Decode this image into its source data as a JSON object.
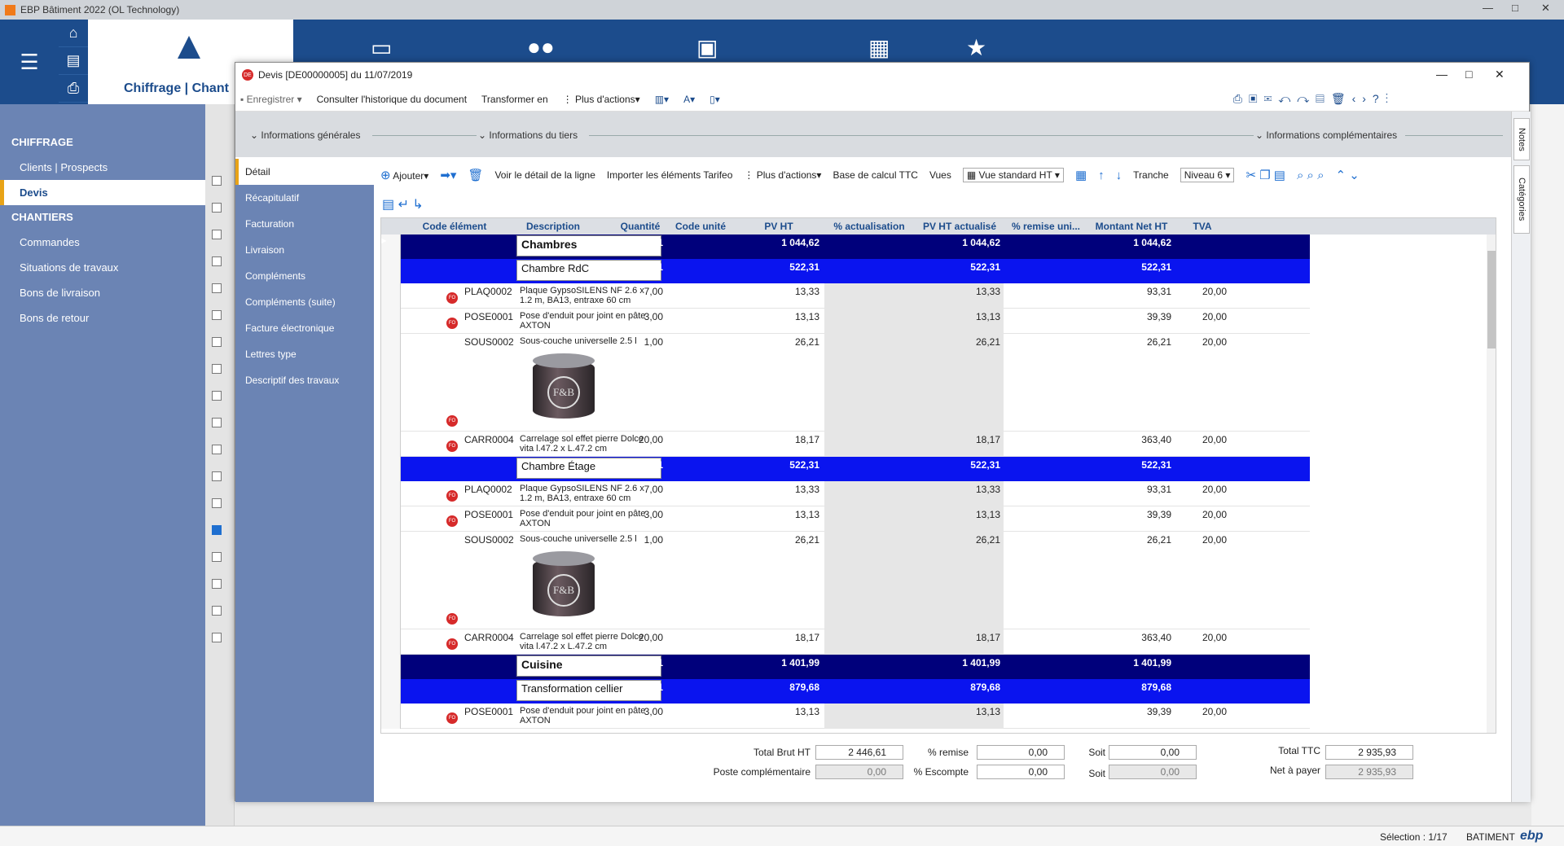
{
  "app": {
    "title": "EBP Bâtiment 2022 (OL Technology)"
  },
  "module": {
    "label": "Chiffrage | Chant"
  },
  "sidebar": {
    "sections": [
      {
        "title": "CHIFFRAGE",
        "items": [
          "Clients | Prospects",
          "Devis"
        ]
      },
      {
        "title": "CHANTIERS",
        "items": [
          "Commandes",
          "Situations de travaux",
          "Bons de livraison",
          "Bons de retour"
        ]
      }
    ],
    "active": "Devis"
  },
  "dialog": {
    "title": "Devis [DE00000005] du 11/07/2019",
    "badge": "DE",
    "toolbar": {
      "save": "Enregistrer",
      "history": "Consulter l'historique du document",
      "transform": "Transformer en",
      "more": "Plus d'actions"
    },
    "sections": [
      "Informations générales",
      "Informations du tiers",
      "Informations complémentaires"
    ],
    "side_tabs": [
      "Détail",
      "Récapitulatif",
      "Facturation",
      "Livraison",
      "Compléments",
      "Compléments (suite)",
      "Facture électronique",
      "Lettres type",
      "Descriptif des travaux"
    ],
    "right_tabs": [
      "Notes",
      "Catégories"
    ]
  },
  "content_toolbar": {
    "add": "Ajouter",
    "view_detail": "Voir le détail de la ligne",
    "import": "Importer les éléments Tarifeo",
    "more": "Plus d'actions",
    "base": "Base de calcul TTC",
    "views_label": "Vues",
    "views_value": "Vue standard HT",
    "tranche_label": "Tranche",
    "tranche_value": "Niveau 6"
  },
  "grid": {
    "columns": [
      "Code élément",
      "Description",
      "Quantité",
      "Code unité",
      "PV HT",
      "% actualisation",
      "PV HT actualisé",
      "% remise uni...",
      "Montant Net HT",
      "TVA"
    ],
    "rows": [
      {
        "level": 1,
        "desc": "Chambres",
        "qty": "1",
        "pv": "1 044,62",
        "pva": "1 044,62",
        "net": "1 044,62"
      },
      {
        "level": 2,
        "desc": "Chambre RdC",
        "qty": "1",
        "pv": "522,31",
        "pva": "522,31",
        "net": "522,31"
      },
      {
        "level": 3,
        "code": "PLAQ0002",
        "desc": "Plaque GypsoSILENS NF 2.6 x 1.2 m, BA13, entraxe 60 cm",
        "qty": "7,00",
        "pv": "13,33",
        "pva": "13,33",
        "net": "93,31",
        "tva": "20,00"
      },
      {
        "level": 3,
        "code": "POSE0001",
        "desc": "Pose d'enduit pour joint en pâte AXTON",
        "qty": "3,00",
        "pv": "13,13",
        "pva": "13,13",
        "net": "39,39",
        "tva": "20,00"
      },
      {
        "level": 3,
        "code": "SOUS0002",
        "desc": "Sous-couche universelle 2.5 l",
        "qty": "1,00",
        "pv": "26,21",
        "pva": "26,21",
        "net": "26,21",
        "tva": "20,00",
        "image": "F&B"
      },
      {
        "level": 3,
        "code": "CARR0004",
        "desc": "Carrelage sol effet pierre Dolce vita l.47.2 x L.47.2 cm",
        "qty": "20,00",
        "pv": "18,17",
        "pva": "18,17",
        "net": "363,40",
        "tva": "20,00"
      },
      {
        "level": 2,
        "desc": "Chambre Étage",
        "qty": "1",
        "pv": "522,31",
        "pva": "522,31",
        "net": "522,31"
      },
      {
        "level": 3,
        "code": "PLAQ0002",
        "desc": "Plaque GypsoSILENS NF 2.6 x 1.2 m, BA13, entraxe 60 cm",
        "qty": "7,00",
        "pv": "13,33",
        "pva": "13,33",
        "net": "93,31",
        "tva": "20,00"
      },
      {
        "level": 3,
        "code": "POSE0001",
        "desc": "Pose d'enduit pour joint en pâte AXTON",
        "qty": "3,00",
        "pv": "13,13",
        "pva": "13,13",
        "net": "39,39",
        "tva": "20,00"
      },
      {
        "level": 3,
        "code": "SOUS0002",
        "desc": "Sous-couche universelle 2.5 l",
        "qty": "1,00",
        "pv": "26,21",
        "pva": "26,21",
        "net": "26,21",
        "tva": "20,00",
        "image": "F&B"
      },
      {
        "level": 3,
        "code": "CARR0004",
        "desc": "Carrelage sol effet pierre Dolce vita l.47.2 x L.47.2 cm",
        "qty": "20,00",
        "pv": "18,17",
        "pva": "18,17",
        "net": "363,40",
        "tva": "20,00"
      },
      {
        "level": 1,
        "desc": "Cuisine",
        "qty": "1",
        "pv": "1 401,99",
        "pva": "1 401,99",
        "net": "1 401,99"
      },
      {
        "level": 2,
        "desc": "Transformation cellier",
        "qty": "1",
        "pv": "879,68",
        "pva": "879,68",
        "net": "879,68"
      },
      {
        "level": 3,
        "code": "POSE0001",
        "desc": "Pose d'enduit pour joint en pâte AXTON",
        "qty": "3,00",
        "pv": "13,13",
        "pva": "13,13",
        "net": "39,39",
        "tva": "20,00"
      }
    ]
  },
  "footer": {
    "total_brut_label": "Total Brut HT",
    "total_brut": "2 446,61",
    "poste_label": "Poste complémentaire",
    "poste": "0,00",
    "remise_label": "% remise",
    "remise": "0,00",
    "escompte_label": "% Escompte",
    "escompte": "0,00",
    "soit_label": "Soit",
    "soit1": "0,00",
    "soit2": "0,00",
    "ttc_label": "Total TTC",
    "ttc": "2 935,93",
    "net_label": "Net à payer",
    "net": "2 935,93"
  },
  "status": {
    "selection": "Sélection : 1/17",
    "module": "BATIMENT",
    "brand": "ebp"
  },
  "fo_badge": "FO",
  "colors": {
    "nav": "#1c4c8c",
    "sidebar": "#6b84b4",
    "level1": "#00007b",
    "level2": "#0a14ef",
    "accent": "#e8a317"
  }
}
